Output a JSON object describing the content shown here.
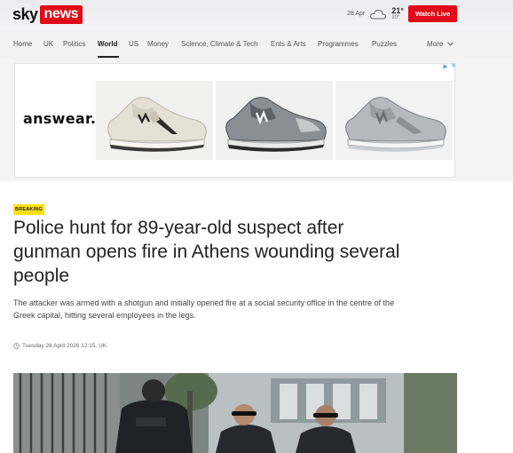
{
  "header": {
    "logo_sky": "sky",
    "logo_news": "news",
    "weather": {
      "date": "28 Apr",
      "icon": "cloud-icon",
      "temp_high": "21°",
      "temp_low": "10°"
    },
    "watch_live_label": "Watch Live"
  },
  "nav": {
    "items": [
      {
        "label": "Home",
        "active": false
      },
      {
        "label": "UK",
        "active": false
      },
      {
        "label": "Politics",
        "active": false
      },
      {
        "label": "World",
        "active": true
      },
      {
        "label": "US",
        "active": false
      },
      {
        "label": "Money",
        "active": false
      },
      {
        "label": "Science, Climate & Tech",
        "active": false
      },
      {
        "label": "Ents & Arts",
        "active": false
      },
      {
        "label": "Programmes",
        "active": false
      },
      {
        "label": "Puzzles",
        "active": false
      }
    ],
    "more_label": "More"
  },
  "ad": {
    "brand": "answear.",
    "adchoices_icon": "adchoices-icon",
    "close_label": "✕",
    "products": [
      "cream-sneaker",
      "grey-sneaker",
      "silver-sneaker"
    ]
  },
  "article": {
    "badge": "BREAKING",
    "headline": "Police hunt for 89-year-old suspect after gunman opens fire in Athens wounding several people",
    "standfirst": "The attacker was armed with a shotgun and initially opened fire at a social security office in the centre of the Greek capital, hitting several employees in the legs.",
    "timestamp": "Tuesday 28 April 2026 12:15, UK"
  },
  "colors": {
    "brand_red": "#e10b17",
    "breaking_yellow": "#ffe017",
    "text_dark": "#222222"
  }
}
